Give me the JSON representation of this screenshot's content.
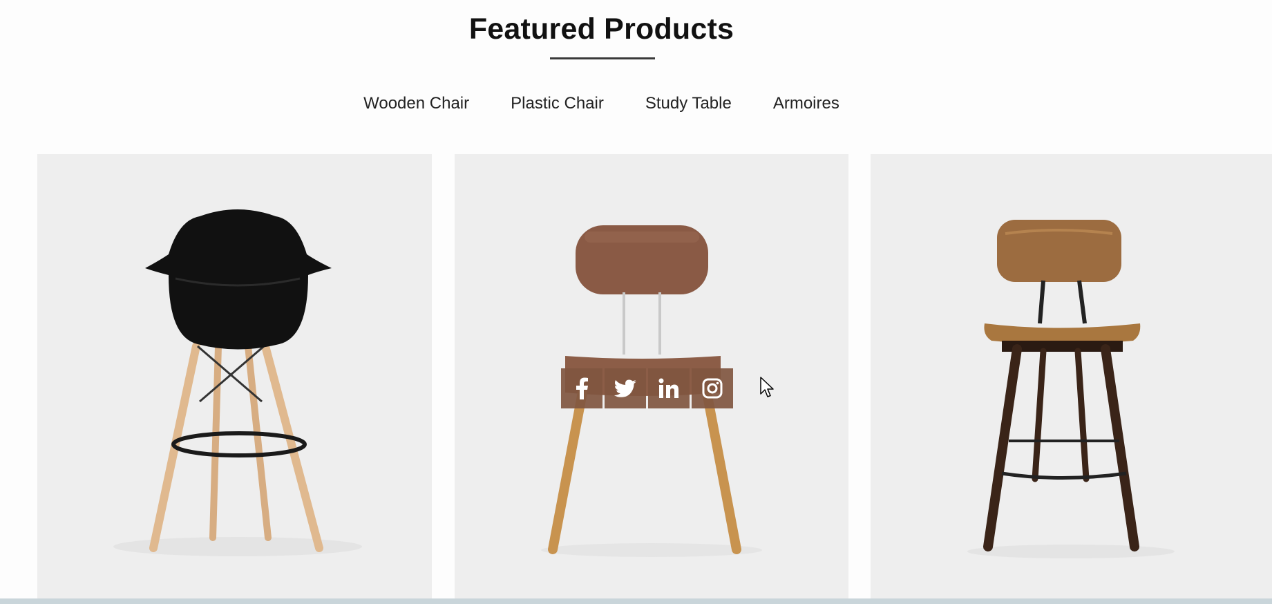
{
  "section": {
    "title": "Featured Products"
  },
  "tabs": [
    {
      "label": "Wooden Chair"
    },
    {
      "label": "Plastic Chair"
    },
    {
      "label": "Study Table"
    },
    {
      "label": "Armoires"
    }
  ],
  "products": [
    {
      "image": "black-plastic-bar-stool"
    },
    {
      "image": "brown-wooden-chair"
    },
    {
      "image": "walnut-counter-stool"
    }
  ],
  "share": {
    "icons": [
      "facebook-icon",
      "twitter-icon",
      "linkedin-icon",
      "instagram-icon"
    ],
    "color": "#80563f"
  },
  "colors": {
    "card_background": "#eeeeee",
    "text": "#111111"
  }
}
